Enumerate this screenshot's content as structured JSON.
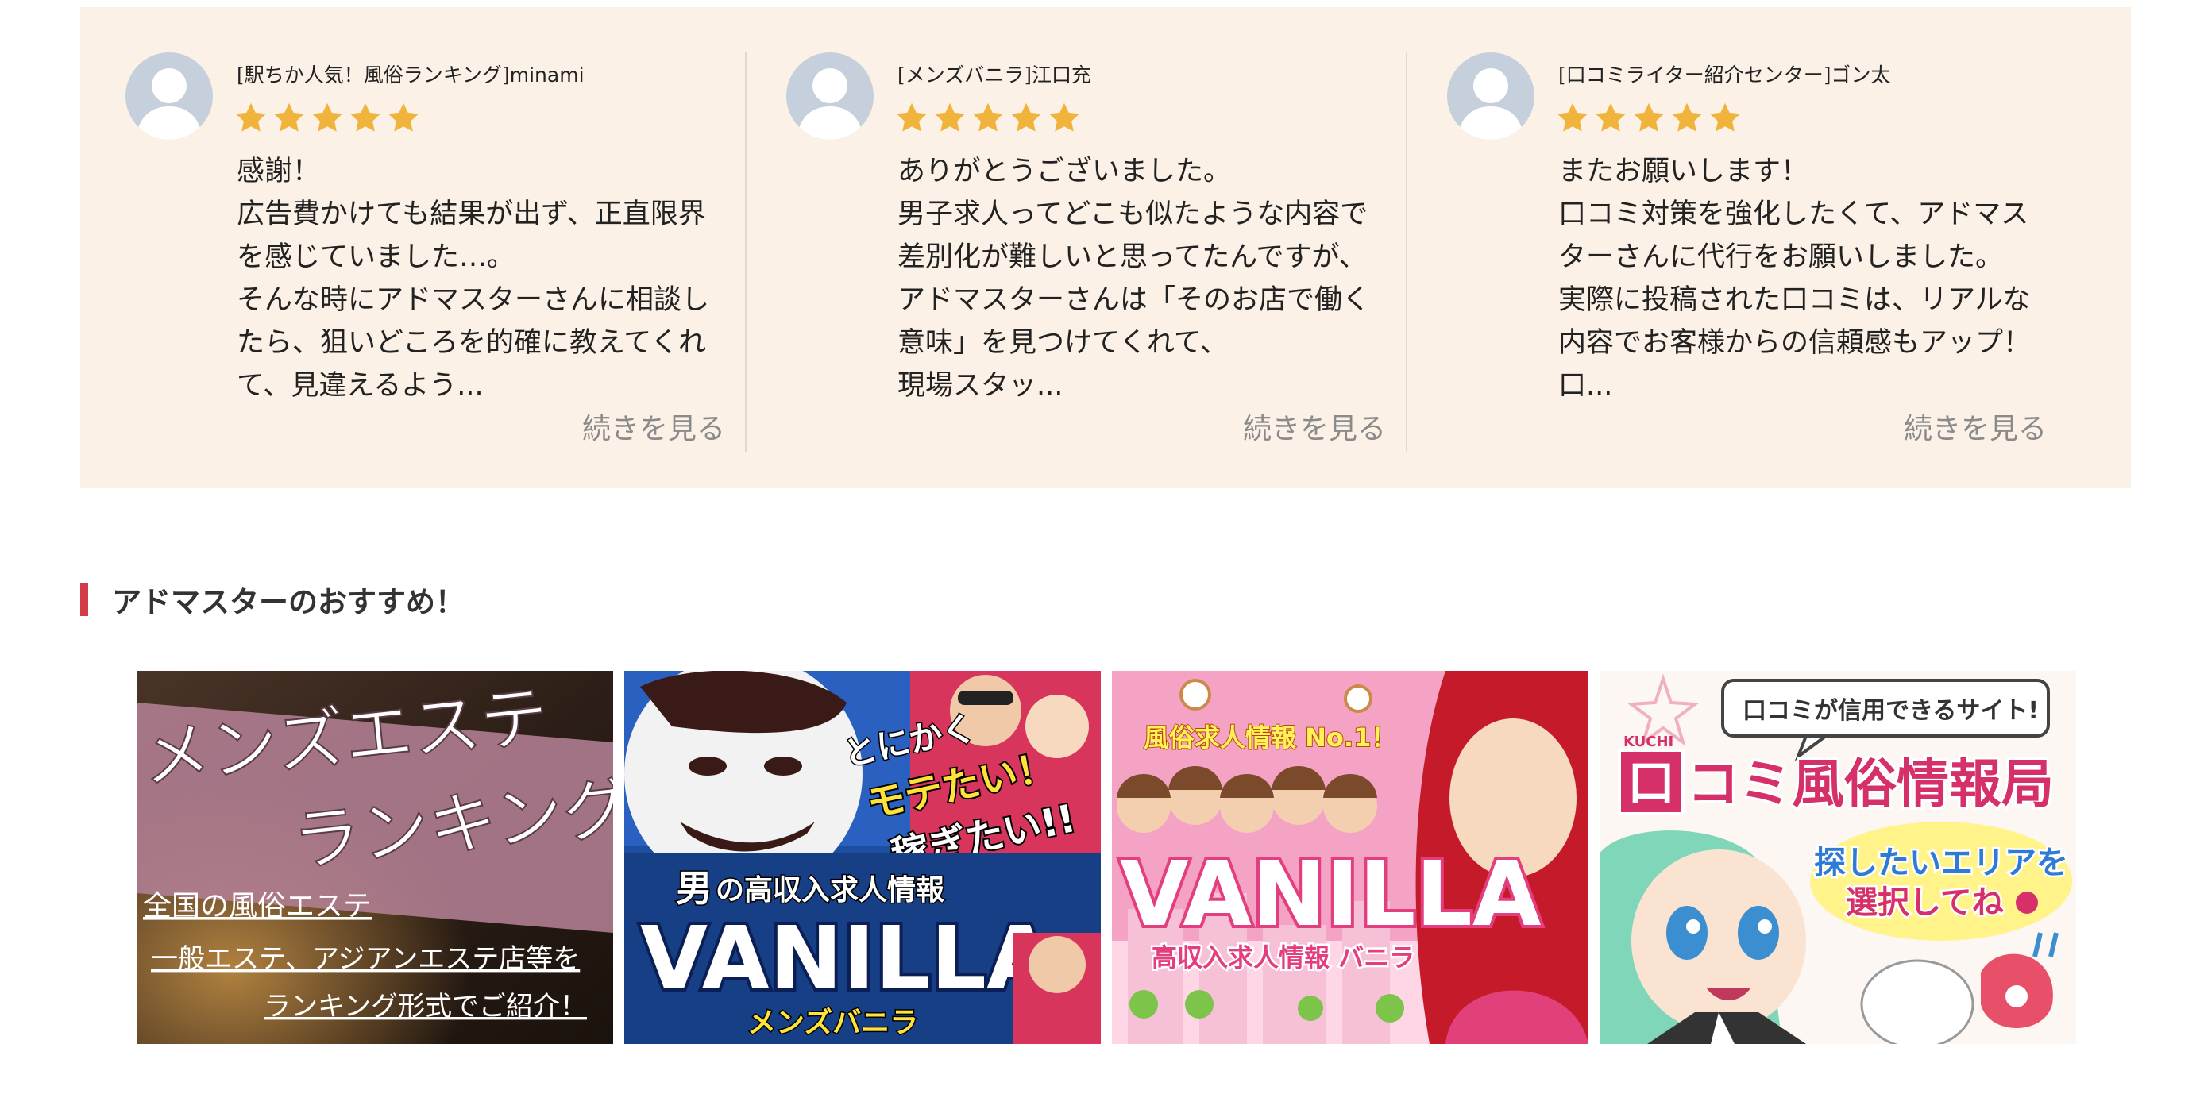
{
  "reviews": [
    {
      "reviewer": "[駅ちか人気！風俗ランキング]minami",
      "rating": 5,
      "lines": [
        "感謝！",
        "広告費かけても結果が出ず、正直限界",
        "を感じていました…。",
        "そんな時にアドマスターさんに相談し",
        "たら、狙いどころを的確に教えてくれ",
        "て、見違えるよう..."
      ],
      "read_more": "続きを見る"
    },
    {
      "reviewer": "[メンズバニラ]江口充",
      "rating": 5,
      "lines": [
        "ありがとうございました。",
        "男子求人ってどこも似たような内容で",
        "差別化が難しいと思ってたんですが、",
        "アドマスターさんは「そのお店で働く",
        "意味」を見つけてくれて、",
        "現場スタッ..."
      ],
      "read_more": "続きを見る"
    },
    {
      "reviewer": "[口コミライター紹介センター]ゴン太",
      "rating": 5,
      "lines": [
        "またお願いします！",
        "口コミ対策を強化したくて、アドマス",
        "ターさんに代行をお願いしました。",
        "実際に投稿された口コミは、リアルな",
        "内容でお客様からの信頼感もアップ！",
        "口..."
      ],
      "read_more": "続きを見る"
    }
  ],
  "section": {
    "title": "アドマスターのおすすめ！"
  },
  "banners": [
    {
      "title_line1": "メンズエステ",
      "title_line2": "ランキング",
      "sub_line1": "全国の風俗エステ",
      "sub_line2": "一般エステ、アジアンエステ店等を",
      "sub_line3": "ランキング形式でご紹介！"
    },
    {
      "tag_line1": "とにかく",
      "tag_line2": "モテたい！",
      "tag_line3": "稼ぎたい!!",
      "kicker_big": "男",
      "kicker": "の高収入求人情報",
      "logo": "VANILLA",
      "sub": "メンズバニラ"
    },
    {
      "tag": "風俗求人情報 No.1！",
      "logo": "VANILLA",
      "sub": "高収入求人情報 バニラ"
    },
    {
      "bubble": "口コミが信用できるサイト!",
      "kuchi": "KUCHI",
      "logo_box": "口",
      "logo_text": "コミ風俗情報局",
      "cta_line1": "探したいエリアを",
      "cta_line2": "選択してね"
    }
  ],
  "colors": {
    "panel_bg": "#fcf1e6",
    "star": "#f0b43c",
    "accent_bar": "#d23b45",
    "read_more": "#8a8a8a"
  }
}
